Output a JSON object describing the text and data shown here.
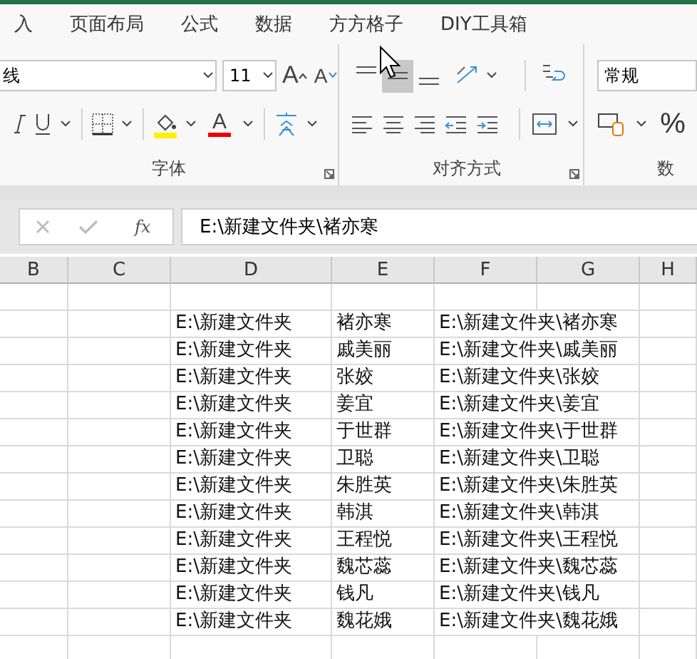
{
  "tabs": [
    {
      "label": "入"
    },
    {
      "label": "页面布局"
    },
    {
      "label": "公式"
    },
    {
      "label": "数据"
    },
    {
      "label": "方方格子"
    },
    {
      "label": "DIY工具箱"
    }
  ],
  "font_group": {
    "font_name": "线",
    "font_size": "11",
    "grow_label": "A",
    "shrink_label": "A",
    "color_label": "A",
    "label": "字体"
  },
  "alignment_group": {
    "vertical_align": [
      {
        "kind": "top",
        "selected": false
      },
      {
        "kind": "middle",
        "selected": true
      },
      {
        "kind": "bottom",
        "selected": false
      }
    ],
    "label": "对齐方式"
  },
  "number_group": {
    "format": "常规",
    "percent": "%",
    "label": "数"
  },
  "formula_bar": {
    "function_label": "fx",
    "value": "E:\\新建文件夹\\褚亦寒"
  },
  "columns": [
    "B",
    "C",
    "D",
    "E",
    "F",
    "G",
    "H"
  ],
  "rows": [
    {
      "d": "E:\\新建文件夹",
      "e": "褚亦寒",
      "f": "E:\\新建文件夹\\褚亦寒"
    },
    {
      "d": "E:\\新建文件夹",
      "e": "戚美丽",
      "f": "E:\\新建文件夹\\戚美丽"
    },
    {
      "d": "E:\\新建文件夹",
      "e": "张姣",
      "f": "E:\\新建文件夹\\张姣"
    },
    {
      "d": "E:\\新建文件夹",
      "e": "姜宜",
      "f": "E:\\新建文件夹\\姜宜"
    },
    {
      "d": "E:\\新建文件夹",
      "e": "于世群",
      "f": "E:\\新建文件夹\\于世群"
    },
    {
      "d": "E:\\新建文件夹",
      "e": "卫聪",
      "f": "E:\\新建文件夹\\卫聪"
    },
    {
      "d": "E:\\新建文件夹",
      "e": "朱胜英",
      "f": "E:\\新建文件夹\\朱胜英"
    },
    {
      "d": "E:\\新建文件夹",
      "e": "韩淇",
      "f": "E:\\新建文件夹\\韩淇"
    },
    {
      "d": "E:\\新建文件夹",
      "e": "王程悦",
      "f": "E:\\新建文件夹\\王程悦"
    },
    {
      "d": "E:\\新建文件夹",
      "e": "魏芯蕊",
      "f": "E:\\新建文件夹\\魏芯蕊"
    },
    {
      "d": "E:\\新建文件夹",
      "e": "钱凡",
      "f": "E:\\新建文件夹\\钱凡"
    },
    {
      "d": "E:\\新建文件夹",
      "e": "魏花娥",
      "f": "E:\\新建文件夹\\魏花娥"
    }
  ]
}
